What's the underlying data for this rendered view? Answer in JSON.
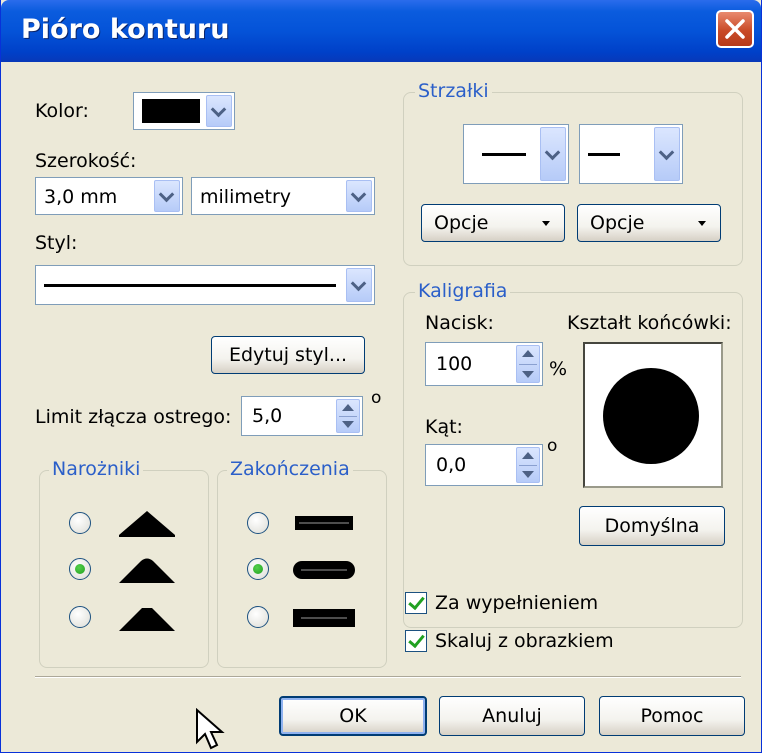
{
  "window": {
    "title": "Pióro konturu"
  },
  "kolor": {
    "label": "Kolor:",
    "value_color": "#000000"
  },
  "szerokosc": {
    "label": "Szerokość:",
    "value": "3,0 mm",
    "unit": "milimetry"
  },
  "styl": {
    "label": "Styl:"
  },
  "edit_style_button": "Edytuj styl...",
  "limit": {
    "label": "Limit złącza ostrego:",
    "value": "5,0",
    "unit": "o"
  },
  "narozniki": {
    "label": "Narożniki",
    "selected_index": 1
  },
  "zakonczenia": {
    "label": "Zakończenia",
    "selected_index": 1
  },
  "strzalki": {
    "label": "Strzałki",
    "options_left": "Opcje",
    "options_right": "Opcje"
  },
  "kaligrafia": {
    "label": "Kaligrafia",
    "nacisk_label": "Nacisk:",
    "nacisk_value": "100",
    "nacisk_unit": "%",
    "kat_label": "Kąt:",
    "kat_value": "0,0",
    "kat_unit": "o",
    "shape_label": "Kształt końcówki:",
    "default_button": "Domyślna"
  },
  "checkboxes": {
    "behind_fill": {
      "label": "Za wypełnieniem",
      "checked": true
    },
    "scale_with_image": {
      "label": "Skaluj z obrazkiem",
      "checked": true
    }
  },
  "buttons": {
    "ok": "OK",
    "cancel": "Anuluj",
    "help": "Pomoc"
  },
  "icons": [
    "close-icon",
    "dropdown-arrow-icon",
    "spin-arrows-icon",
    "corner-miter-icon",
    "corner-round-icon",
    "corner-bevel-icon",
    "cap-butt-icon",
    "cap-round-icon",
    "cap-square-icon",
    "nib-shape-icon",
    "arrow-pointer-icon"
  ]
}
